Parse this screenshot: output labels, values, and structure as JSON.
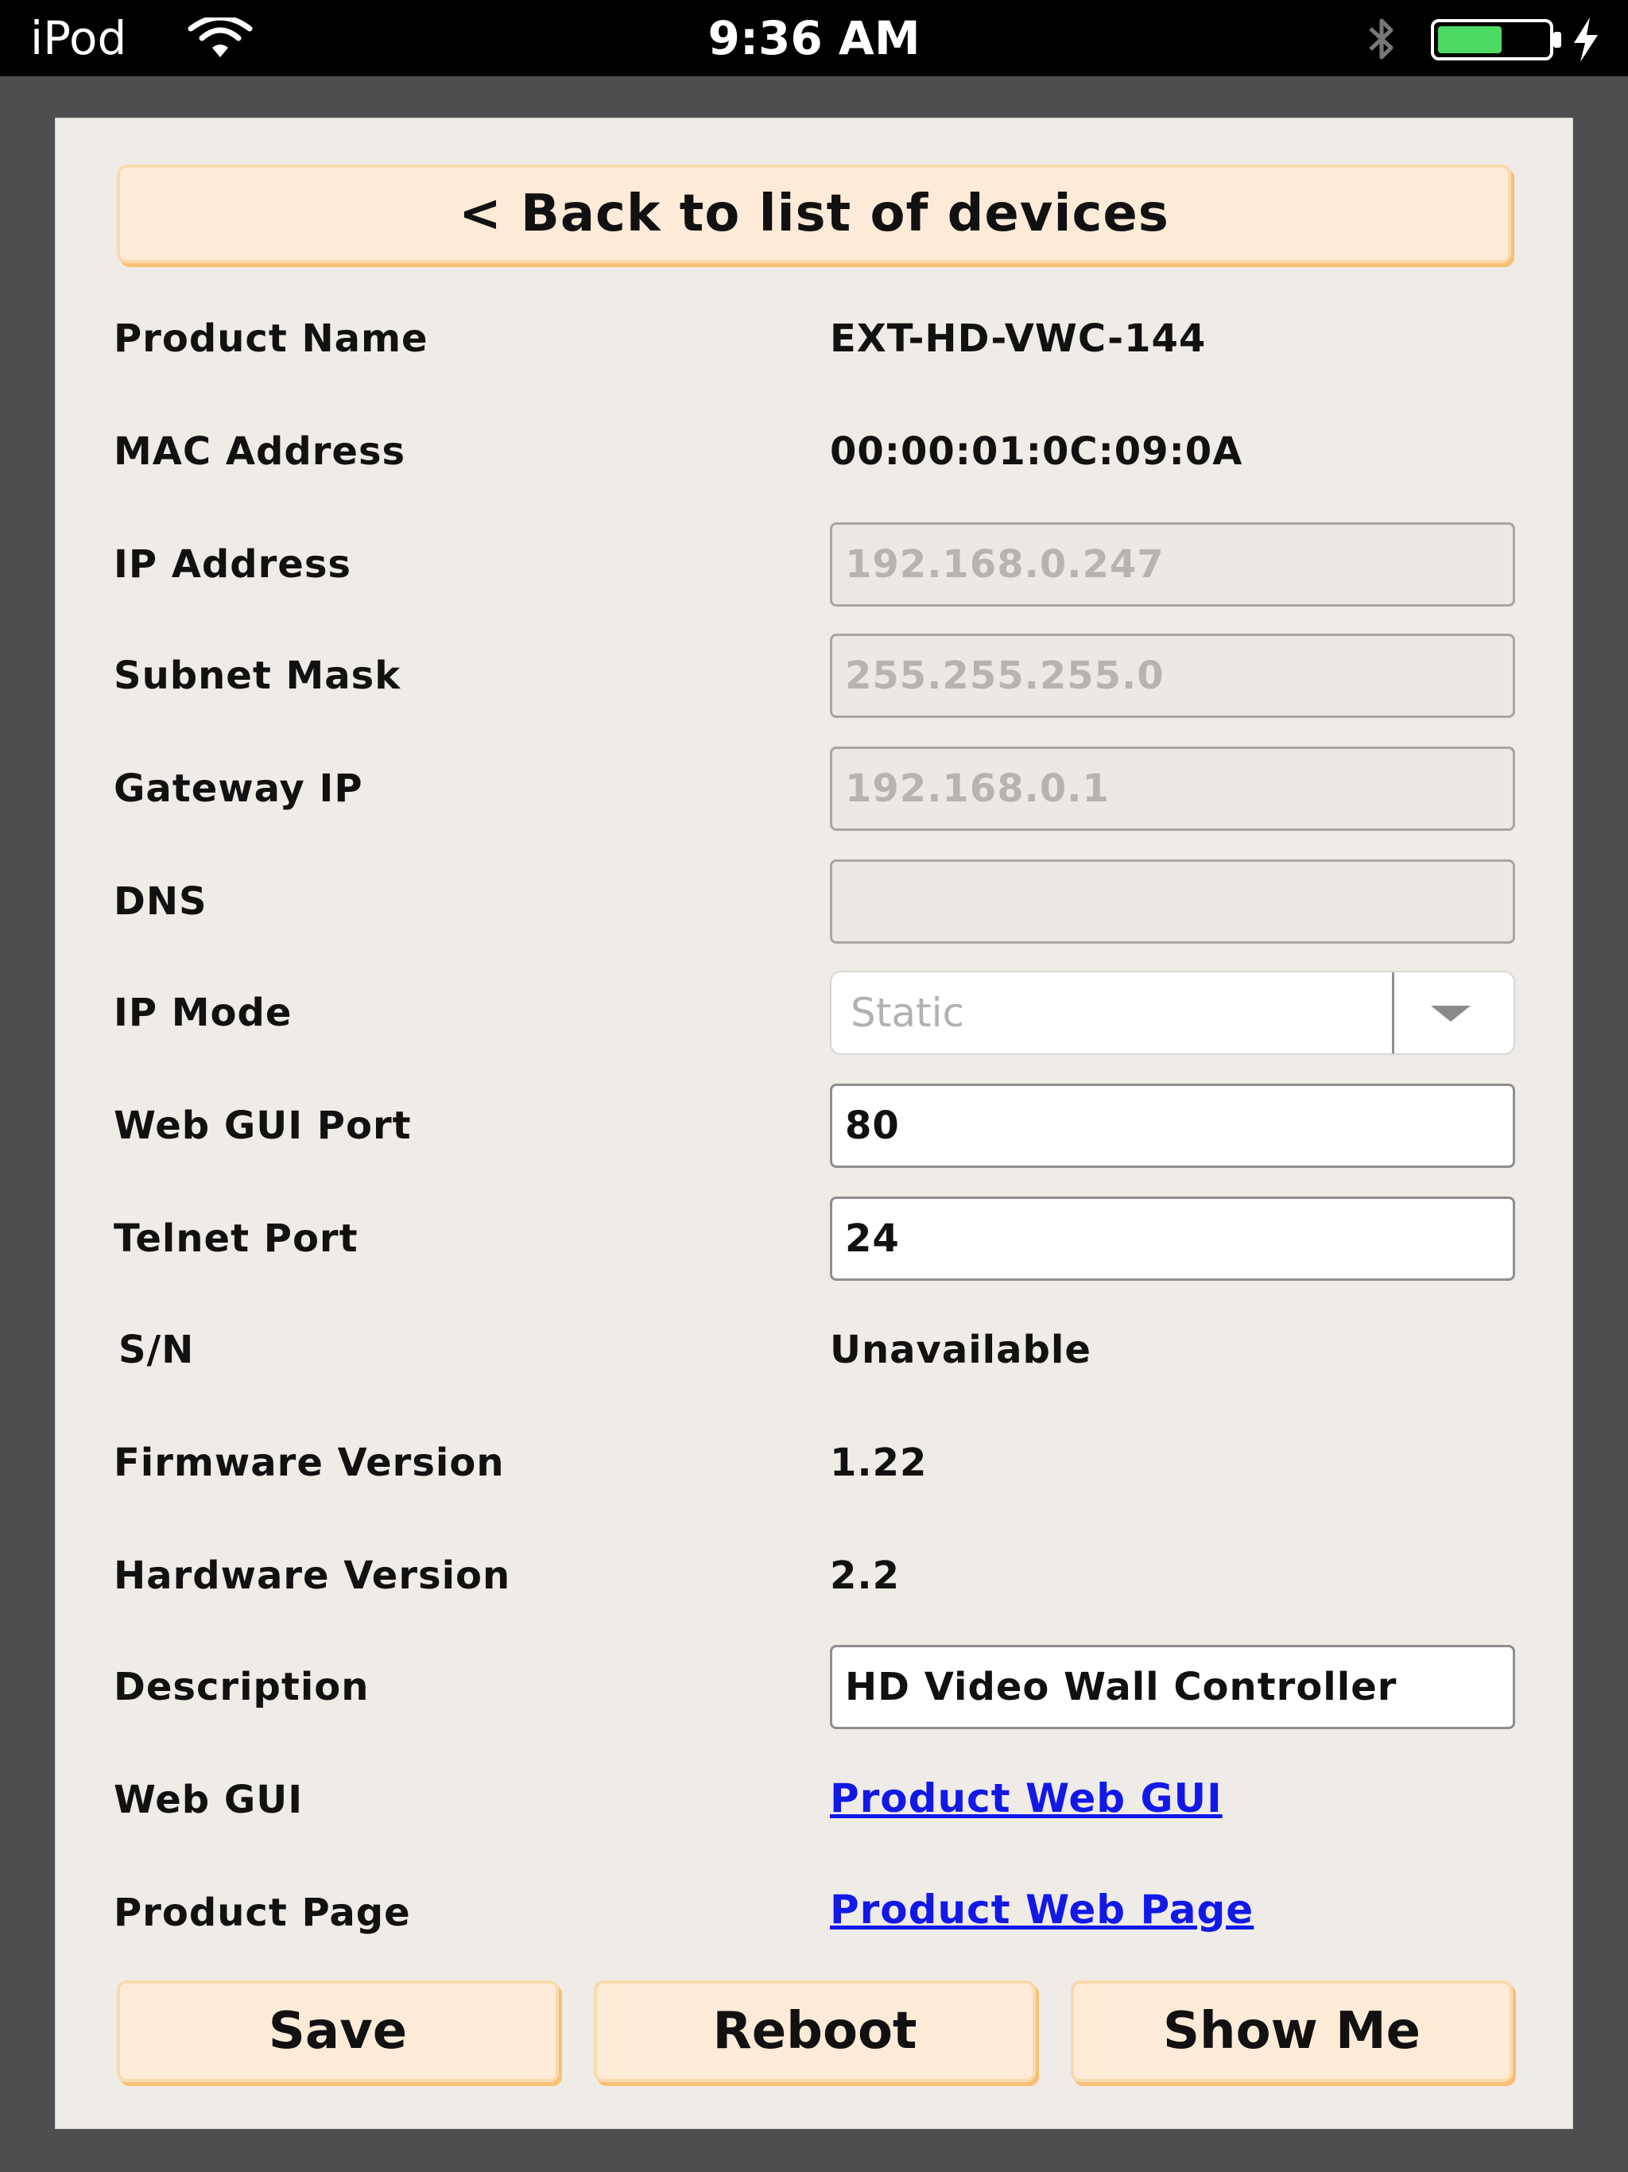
{
  "status_bar": {
    "carrier": "iPod",
    "time": "9:36 AM",
    "icons": [
      "wifi-icon",
      "bluetooth-icon",
      "battery-icon",
      "charging-bolt-icon"
    ],
    "battery_level": 0.55,
    "battery_color": "#4cd964"
  },
  "nav": {
    "back_label": "< Back to list of devices"
  },
  "fields": {
    "product_name": {
      "label": "Product Name",
      "value": "EXT-HD-VWC-144"
    },
    "mac_address": {
      "label": "MAC Address",
      "value": "00:00:01:0C:09:0A"
    },
    "ip_address": {
      "label": "IP Address",
      "value": "192.168.0.247"
    },
    "subnet_mask": {
      "label": "Subnet Mask",
      "value": "255.255.255.0"
    },
    "gateway_ip": {
      "label": "Gateway IP",
      "value": "192.168.0.1"
    },
    "dns": {
      "label": "DNS",
      "value": ""
    },
    "ip_mode": {
      "label": "IP Mode",
      "value": "Static"
    },
    "web_gui_port": {
      "label": "Web GUI Port",
      "value": "80"
    },
    "telnet_port": {
      "label": "Telnet Port",
      "value": "24"
    },
    "serial_number": {
      "label": "S/N",
      "value": "Unavailable"
    },
    "firmware_version": {
      "label": "Firmware Version",
      "value": "1.22"
    },
    "hardware_version": {
      "label": "Hardware Version",
      "value": "2.2"
    },
    "description": {
      "label": "Description",
      "value": "HD Video Wall Controller"
    },
    "web_gui": {
      "label": "Web GUI",
      "link_text": "Product Web GUI"
    },
    "product_page": {
      "label": "Product Page",
      "link_text": "Product Web Page"
    }
  },
  "actions": {
    "save_label": "Save",
    "reboot_label": "Reboot",
    "show_me_label": "Show Me"
  },
  "colors": {
    "button_fill": "#fdebd8",
    "button_shadow": "#f7c076",
    "link": "#1218e6"
  }
}
